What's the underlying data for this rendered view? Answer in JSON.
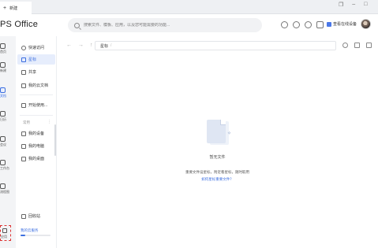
{
  "window": {
    "tab_label": "新建",
    "app_title": "PS Office"
  },
  "search": {
    "placeholder": "搜索文件、模板、应用，以及您可能需要的功能..."
  },
  "header": {
    "sync_label": "查看在线设备"
  },
  "left_rail": {
    "items": [
      {
        "label": "首页"
      },
      {
        "label": "新建"
      },
      {
        "label": "文档"
      },
      {
        "label": "日历"
      },
      {
        "label": "会议"
      },
      {
        "label": "工作台"
      },
      {
        "label": "流程图"
      },
      {
        "label": "应用"
      }
    ]
  },
  "sidebar": {
    "nav": [
      {
        "icon": "clock-icon",
        "label": "快速访问",
        "active": false
      },
      {
        "icon": "star-icon",
        "label": "星标",
        "active": true
      },
      {
        "icon": "share-icon",
        "label": "共享",
        "active": false
      },
      {
        "icon": "cloud-icon",
        "label": "我的云文档",
        "active": false
      },
      {
        "icon": "folder-icon",
        "label": "开始使用...",
        "active": false
      }
    ],
    "section_title": "常用",
    "devices": [
      {
        "icon": "device-icon",
        "label": "我的设备"
      },
      {
        "icon": "computer-icon",
        "label": "我的电脑"
      },
      {
        "icon": "desktop-icon",
        "label": "我的桌面"
      }
    ],
    "recycle_label": "回收站",
    "cloud_space_label": "我的云服务"
  },
  "path_bar": {
    "current": "星标"
  },
  "empty_state": {
    "title": "暂无文件",
    "description": "重要文件设星标，附近看星标，随时取用",
    "link": "如何星标重要文件？"
  }
}
